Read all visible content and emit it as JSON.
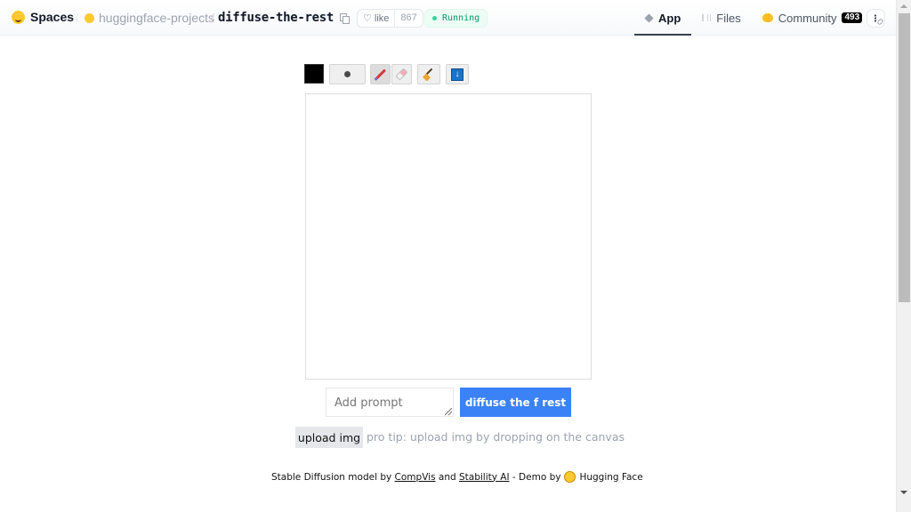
{
  "header": {
    "brand_label": "Spaces",
    "org": "huggingface-projects",
    "separator": "/",
    "repo": "diffuse-the-rest",
    "like_label": "like",
    "like_icon": "♡",
    "like_count": "867",
    "status": "Running",
    "status_color": "#059669",
    "tabs": [
      {
        "label": "App",
        "icon": "cube-icon",
        "active": true
      },
      {
        "label": "Files",
        "icon": "files-icon",
        "active": false
      },
      {
        "label": "Community",
        "icon": "community-icon",
        "active": false,
        "badge": "493"
      }
    ]
  },
  "toolbar": {
    "color": "#000000",
    "tools": [
      "brush-size",
      "brush",
      "eraser",
      "clear",
      "download"
    ],
    "download_glyph": "↓"
  },
  "prompt": {
    "placeholder": "Add prompt",
    "value": ""
  },
  "diffuse_button_label": "diffuse the f rest",
  "diffuse_button_color": "#3b82f6",
  "upload_button_label": "upload img",
  "tip": "pro tip: upload img by dropping on the canvas",
  "footer": {
    "prefix": "Stable Diffusion model by ",
    "link1": "CompVis",
    "and": " and ",
    "link2": "Stability AI",
    "demo_by": " - Demo by",
    "suffix": "Hugging Face"
  },
  "scrollbar": {
    "position_fraction": 0.0,
    "visible_fraction": 0.58
  }
}
